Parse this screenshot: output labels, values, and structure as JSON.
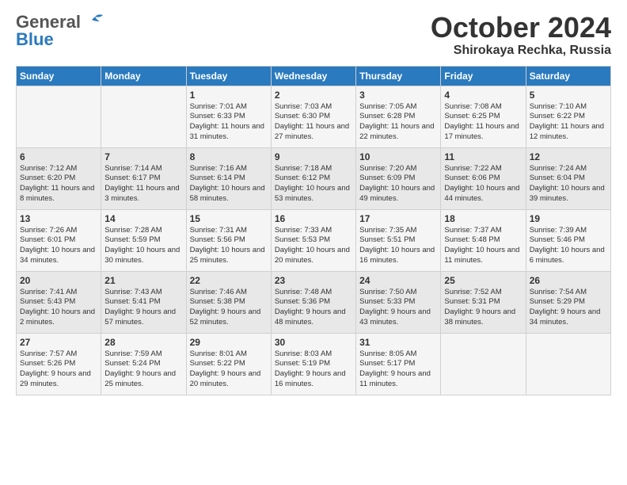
{
  "header": {
    "logo_general": "General",
    "logo_blue": "Blue",
    "month": "October 2024",
    "location": "Shirokaya Rechka, Russia"
  },
  "weekdays": [
    "Sunday",
    "Monday",
    "Tuesday",
    "Wednesday",
    "Thursday",
    "Friday",
    "Saturday"
  ],
  "weeks": [
    [
      {
        "day": "",
        "info": ""
      },
      {
        "day": "",
        "info": ""
      },
      {
        "day": "1",
        "info": "Sunrise: 7:01 AM\nSunset: 6:33 PM\nDaylight: 11 hours\nand 31 minutes."
      },
      {
        "day": "2",
        "info": "Sunrise: 7:03 AM\nSunset: 6:30 PM\nDaylight: 11 hours\nand 27 minutes."
      },
      {
        "day": "3",
        "info": "Sunrise: 7:05 AM\nSunset: 6:28 PM\nDaylight: 11 hours\nand 22 minutes."
      },
      {
        "day": "4",
        "info": "Sunrise: 7:08 AM\nSunset: 6:25 PM\nDaylight: 11 hours\nand 17 minutes."
      },
      {
        "day": "5",
        "info": "Sunrise: 7:10 AM\nSunset: 6:22 PM\nDaylight: 11 hours\nand 12 minutes."
      }
    ],
    [
      {
        "day": "6",
        "info": "Sunrise: 7:12 AM\nSunset: 6:20 PM\nDaylight: 11 hours\nand 8 minutes."
      },
      {
        "day": "7",
        "info": "Sunrise: 7:14 AM\nSunset: 6:17 PM\nDaylight: 11 hours\nand 3 minutes."
      },
      {
        "day": "8",
        "info": "Sunrise: 7:16 AM\nSunset: 6:14 PM\nDaylight: 10 hours\nand 58 minutes."
      },
      {
        "day": "9",
        "info": "Sunrise: 7:18 AM\nSunset: 6:12 PM\nDaylight: 10 hours\nand 53 minutes."
      },
      {
        "day": "10",
        "info": "Sunrise: 7:20 AM\nSunset: 6:09 PM\nDaylight: 10 hours\nand 49 minutes."
      },
      {
        "day": "11",
        "info": "Sunrise: 7:22 AM\nSunset: 6:06 PM\nDaylight: 10 hours\nand 44 minutes."
      },
      {
        "day": "12",
        "info": "Sunrise: 7:24 AM\nSunset: 6:04 PM\nDaylight: 10 hours\nand 39 minutes."
      }
    ],
    [
      {
        "day": "13",
        "info": "Sunrise: 7:26 AM\nSunset: 6:01 PM\nDaylight: 10 hours\nand 34 minutes."
      },
      {
        "day": "14",
        "info": "Sunrise: 7:28 AM\nSunset: 5:59 PM\nDaylight: 10 hours\nand 30 minutes."
      },
      {
        "day": "15",
        "info": "Sunrise: 7:31 AM\nSunset: 5:56 PM\nDaylight: 10 hours\nand 25 minutes."
      },
      {
        "day": "16",
        "info": "Sunrise: 7:33 AM\nSunset: 5:53 PM\nDaylight: 10 hours\nand 20 minutes."
      },
      {
        "day": "17",
        "info": "Sunrise: 7:35 AM\nSunset: 5:51 PM\nDaylight: 10 hours\nand 16 minutes."
      },
      {
        "day": "18",
        "info": "Sunrise: 7:37 AM\nSunset: 5:48 PM\nDaylight: 10 hours\nand 11 minutes."
      },
      {
        "day": "19",
        "info": "Sunrise: 7:39 AM\nSunset: 5:46 PM\nDaylight: 10 hours\nand 6 minutes."
      }
    ],
    [
      {
        "day": "20",
        "info": "Sunrise: 7:41 AM\nSunset: 5:43 PM\nDaylight: 10 hours\nand 2 minutes."
      },
      {
        "day": "21",
        "info": "Sunrise: 7:43 AM\nSunset: 5:41 PM\nDaylight: 9 hours\nand 57 minutes."
      },
      {
        "day": "22",
        "info": "Sunrise: 7:46 AM\nSunset: 5:38 PM\nDaylight: 9 hours\nand 52 minutes."
      },
      {
        "day": "23",
        "info": "Sunrise: 7:48 AM\nSunset: 5:36 PM\nDaylight: 9 hours\nand 48 minutes."
      },
      {
        "day": "24",
        "info": "Sunrise: 7:50 AM\nSunset: 5:33 PM\nDaylight: 9 hours\nand 43 minutes."
      },
      {
        "day": "25",
        "info": "Sunrise: 7:52 AM\nSunset: 5:31 PM\nDaylight: 9 hours\nand 38 minutes."
      },
      {
        "day": "26",
        "info": "Sunrise: 7:54 AM\nSunset: 5:29 PM\nDaylight: 9 hours\nand 34 minutes."
      }
    ],
    [
      {
        "day": "27",
        "info": "Sunrise: 7:57 AM\nSunset: 5:26 PM\nDaylight: 9 hours\nand 29 minutes."
      },
      {
        "day": "28",
        "info": "Sunrise: 7:59 AM\nSunset: 5:24 PM\nDaylight: 9 hours\nand 25 minutes."
      },
      {
        "day": "29",
        "info": "Sunrise: 8:01 AM\nSunset: 5:22 PM\nDaylight: 9 hours\nand 20 minutes."
      },
      {
        "day": "30",
        "info": "Sunrise: 8:03 AM\nSunset: 5:19 PM\nDaylight: 9 hours\nand 16 minutes."
      },
      {
        "day": "31",
        "info": "Sunrise: 8:05 AM\nSunset: 5:17 PM\nDaylight: 9 hours\nand 11 minutes."
      },
      {
        "day": "",
        "info": ""
      },
      {
        "day": "",
        "info": ""
      }
    ]
  ]
}
